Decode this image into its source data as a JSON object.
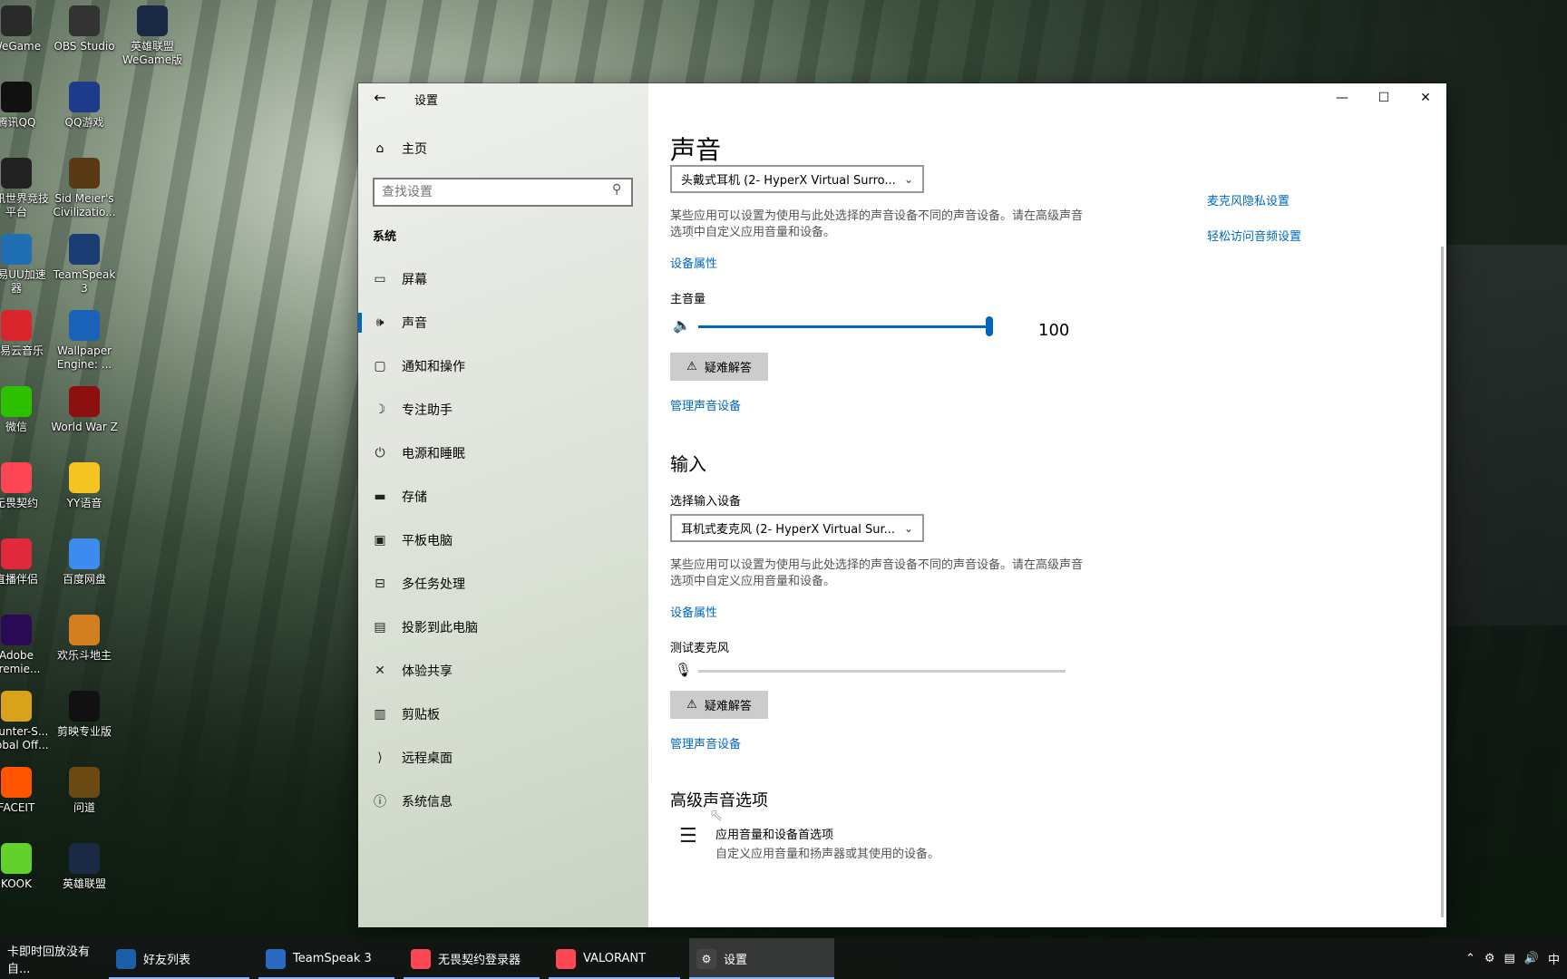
{
  "desktop": {
    "icons": [
      {
        "label": "WeGame",
        "icon": "wegame-icon",
        "color": "#2a2a2a"
      },
      {
        "label": "OBS Studio",
        "icon": "obs-icon",
        "color": "#333333"
      },
      {
        "label": "英雄联盟 WeGame版",
        "icon": "lol-icon",
        "color": "#1a2a44"
      },
      {
        "label": "腾讯QQ",
        "icon": "qq-icon",
        "color": "#111111"
      },
      {
        "label": "QQ游戏",
        "icon": "qq-game-icon",
        "color": "#1e3a8a"
      },
      {
        "label": "腾讯世界竞技平台",
        "icon": "arena-icon",
        "color": "#222222"
      },
      {
        "label": "Sid Meier's Civilizatio...",
        "icon": "civ-icon",
        "color": "#5a3a14"
      },
      {
        "label": "网易UU加速器",
        "icon": "uu-icon",
        "color": "#1f6fb2"
      },
      {
        "label": "TeamSpeak 3",
        "icon": "teamspeak-icon",
        "color": "#1b3d73"
      },
      {
        "label": "网易云音乐",
        "icon": "netease-music-icon",
        "color": "#d9252b"
      },
      {
        "label": "Wallpaper Engine: ...",
        "icon": "wallpaper-engine-icon",
        "color": "#1a62b8"
      },
      {
        "label": "微信",
        "icon": "wechat-icon",
        "color": "#2dc100"
      },
      {
        "label": "World War Z",
        "icon": "wwz-icon",
        "color": "#8c1010"
      },
      {
        "label": "无畏契约",
        "icon": "valorant-icon",
        "color": "#ff4655"
      },
      {
        "label": "YY语音",
        "icon": "yy-icon",
        "color": "#f6c421"
      },
      {
        "label": "直播伴侣",
        "icon": "live-icon",
        "color": "#e02a3c"
      },
      {
        "label": "百度网盘",
        "icon": "baidu-pan-icon",
        "color": "#3c8cf0"
      },
      {
        "label": "Adobe Premie...",
        "icon": "premiere-icon",
        "color": "#2a0a55"
      },
      {
        "label": "欢乐斗地主",
        "icon": "doudizhu-icon",
        "color": "#d47f1f"
      },
      {
        "label": "Counter-S... Global Off...",
        "icon": "csgo-icon",
        "color": "#d9a21b"
      },
      {
        "label": "剪映专业版",
        "icon": "capcut-icon",
        "color": "#111111"
      },
      {
        "label": "FACEIT",
        "icon": "faceit-icon",
        "color": "#ff5500"
      },
      {
        "label": "问道",
        "icon": "wendao-icon",
        "color": "#6a4a12"
      },
      {
        "label": "KOOK",
        "icon": "kook-icon",
        "color": "#63d12c"
      },
      {
        "label": "英雄联盟",
        "icon": "lol2-icon",
        "color": "#1a2a44"
      }
    ]
  },
  "window": {
    "title": "设置",
    "controls": {
      "minimize": "—",
      "maximize": "☐",
      "close": "✕"
    }
  },
  "nav": {
    "home_label": "主页",
    "search_placeholder": "查找设置",
    "section": "系统",
    "items": [
      {
        "label": "屏幕",
        "icon": "display-icon"
      },
      {
        "label": "声音",
        "icon": "speaker-icon",
        "active": true
      },
      {
        "label": "通知和操作",
        "icon": "notification-icon"
      },
      {
        "label": "专注助手",
        "icon": "moon-icon"
      },
      {
        "label": "电源和睡眠",
        "icon": "power-icon"
      },
      {
        "label": "存储",
        "icon": "storage-icon"
      },
      {
        "label": "平板电脑",
        "icon": "tablet-icon"
      },
      {
        "label": "多任务处理",
        "icon": "multitask-icon"
      },
      {
        "label": "投影到此电脑",
        "icon": "project-icon"
      },
      {
        "label": "体验共享",
        "icon": "share-icon"
      },
      {
        "label": "剪贴板",
        "icon": "clipboard-icon"
      },
      {
        "label": "远程桌面",
        "icon": "remote-icon"
      },
      {
        "label": "系统信息",
        "icon": "info-icon"
      }
    ]
  },
  "content": {
    "title": "声音",
    "output": {
      "device": "头戴式耳机 (2- HyperX Virtual Surro...",
      "desc": "某些应用可以设置为使用与此处选择的声音设备不同的声音设备。请在高级声音选项中自定义应用音量和设备。",
      "props_link": "设备属性",
      "volume_label": "主音量",
      "volume_value": "100",
      "troubleshoot": "疑难解答",
      "manage_link": "管理声音设备"
    },
    "input": {
      "heading": "输入",
      "select_label": "选择输入设备",
      "device": "耳机式麦克风 (2- HyperX Virtual Sur...",
      "desc": "某些应用可以设置为使用与此处选择的声音设备不同的声音设备。请在高级声音选项中自定义应用音量和设备。",
      "props_link": "设备属性",
      "test_label": "测试麦克风",
      "mic_level": 0,
      "troubleshoot": "疑难解答",
      "manage_link": "管理声音设备"
    },
    "advanced": {
      "heading": "高级声音选项",
      "item_title": "应用音量和设备首选项",
      "item_sub": "自定义应用音量和扬声器或其使用的设备。"
    },
    "related_links": [
      "麦克风隐私设置",
      "轻松访问音频设置"
    ]
  },
  "taskbar": {
    "items": [
      {
        "label": "卡即时回放没有自...",
        "icon": "none"
      },
      {
        "label": "好友列表",
        "icon": "steam-icon",
        "color": "#1b5fa8"
      },
      {
        "label": "TeamSpeak 3",
        "icon": "teamspeak-icon",
        "color": "#2a6bc1"
      },
      {
        "label": "无畏契约登录器",
        "icon": "valorant-icon",
        "color": "#ff4655"
      },
      {
        "label": "VALORANT",
        "icon": "valorant-icon",
        "color": "#ff4655"
      },
      {
        "label": "设置",
        "icon": "gear-icon",
        "color": "#444444",
        "active": true
      }
    ],
    "tray": {
      "ime": "中"
    }
  },
  "colors": {
    "accent": "#0067c0",
    "link": "#0067c0"
  }
}
